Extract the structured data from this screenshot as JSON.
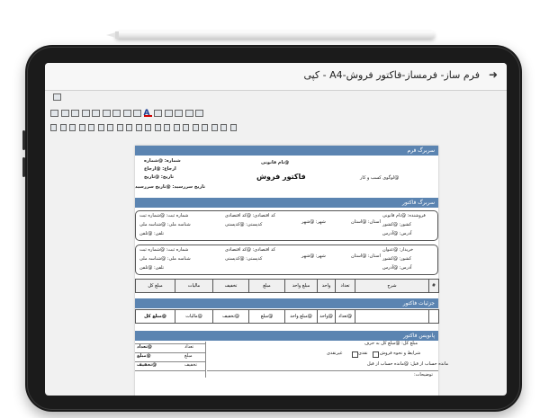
{
  "window": {
    "title": "فرم ساز- فرمساز-فاکتور فروش-A4 - کپی",
    "back_icon": "arrow-right-icon"
  },
  "toolbar": {
    "row1_icons": [
      "image-icon"
    ],
    "row2_icons": [
      "table-icon",
      "table-icon",
      "table-icon",
      "table-icon",
      "table-icon",
      "table-icon",
      "table-icon",
      "table-icon",
      "table-icon",
      "font-color-icon",
      "highlight-icon",
      "list-icon",
      "format-icon",
      "number-icon",
      "refresh-icon"
    ],
    "row3_icons": [
      "align-icon",
      "align-icon",
      "align-icon",
      "align-icon",
      "align-icon",
      "align-icon",
      "align-icon",
      "align-icon",
      "align-icon",
      "align-icon",
      "align-icon",
      "align-icon",
      "align-icon",
      "align-icon",
      "align-icon",
      "align-icon",
      "align-icon",
      "align-icon",
      "align-icon",
      "align-icon"
    ],
    "font_color_label": "A"
  },
  "form_header": {
    "band": "سربرگ فرم",
    "left_lines": [
      "شماره: @شماره",
      "ارجاع: @ارجاع",
      "تاریخ: @تاریخ",
      "تاریخ سررسید: @تاریخ سررسید"
    ],
    "center_top": "@نام قانونی",
    "center_title": "فاکتور فروش",
    "right": "@لوگوی کسب و کار"
  },
  "invoice_header": {
    "band": "سربرگ فاکتور",
    "seller": {
      "col_left": [
        "شماره ثبت: @شماره ثبت",
        "شناسه ملی: @شناسه ملی",
        "تلفن: @تلفن"
      ],
      "col_mid": [
        "کد اقتصادی: @کد اقتصادی",
        "کدپستی: @کدپستی"
      ],
      "col_mid2": [
        "استان: @استان",
        "شهر: @شهر"
      ],
      "col_right": [
        "فروشنده: @نام قانونی",
        "کشور: @کشور",
        "آدرس: @آدرس"
      ]
    },
    "buyer": {
      "col_left": [
        "شماره ثبت: @شماره ثبت",
        "شناسه ملی: @شناسه ملی",
        "تلفن: @تلفن"
      ],
      "col_mid": [
        "کد اقتصادی: @کد اقتصادی",
        "کدپستی: @کدپستی"
      ],
      "col_mid2": [
        "استان: @استان",
        "شهر: @شهر"
      ],
      "col_right": [
        "خریدار: @عنوان",
        "کشور: @کشور",
        "آدرس: @آدرس"
      ]
    }
  },
  "items_table": {
    "headers": [
      "#",
      "شرح",
      "تعداد",
      "واحد",
      "مبلغ واحد",
      "مبلغ",
      "تخفیف",
      "مالیات",
      "مبلغ کل"
    ],
    "band": "جزئیات فاکتور",
    "row": [
      "",
      "",
      "@تعداد",
      "@واحد",
      "@مبلغ واحد",
      "@مبلغ",
      "@تخفیف",
      "@مالیات",
      "@مبلغ کل"
    ]
  },
  "footer": {
    "band": "پانویس فاکتور",
    "total_words": "مبلغ کل: @مبلغ کل به حرف",
    "terms_label": "شرایط و نحوه فروش",
    "cash_label": "نقدی",
    "credit_label": "غیرنقدی",
    "note": "توضیحات:",
    "remaining_prev": "مانده حساب از قبل: @مانده حساب از قبل",
    "summary": [
      {
        "label": "تعداد",
        "value": "@تعداد"
      },
      {
        "label": "مبلغ",
        "value": "@مبلغ"
      },
      {
        "label": "تخفیف",
        "value": "@تخفیف"
      }
    ]
  }
}
